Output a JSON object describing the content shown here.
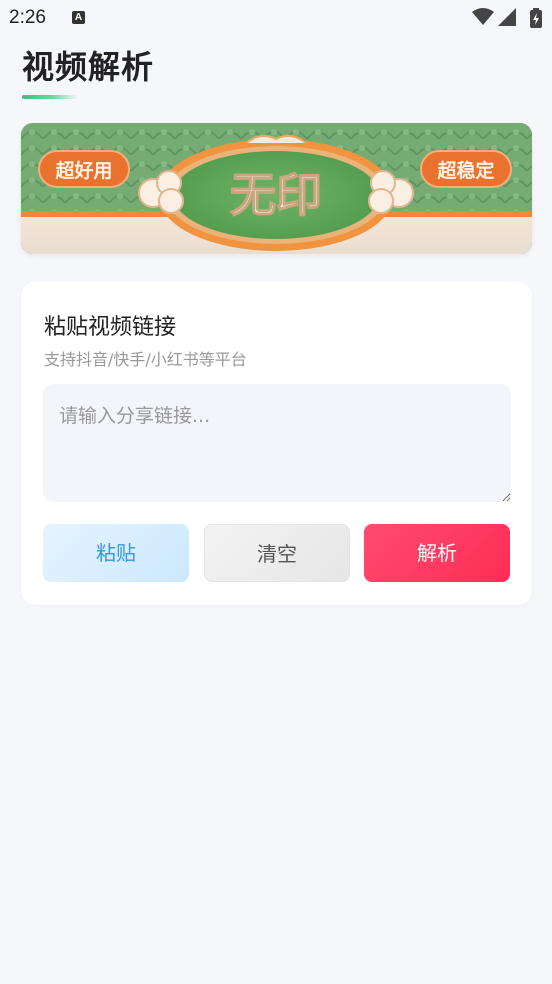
{
  "status_bar": {
    "time": "2:26",
    "notification_letter": "A"
  },
  "page": {
    "title": "视频解析"
  },
  "banner": {
    "left_badge": "超好用",
    "center_text": "无印",
    "right_badge": "超稳定"
  },
  "card": {
    "title": "粘贴视频链接",
    "subtitle": "支持抖音/快手/小红书等平台",
    "input": {
      "placeholder": "请输入分享链接...",
      "value": ""
    },
    "buttons": {
      "paste": "粘贴",
      "clear": "清空",
      "parse": "解析"
    }
  },
  "colors": {
    "accent_red": "#fe2d55",
    "accent_blue": "#2f9be0",
    "underline_green": "#38c07c"
  }
}
